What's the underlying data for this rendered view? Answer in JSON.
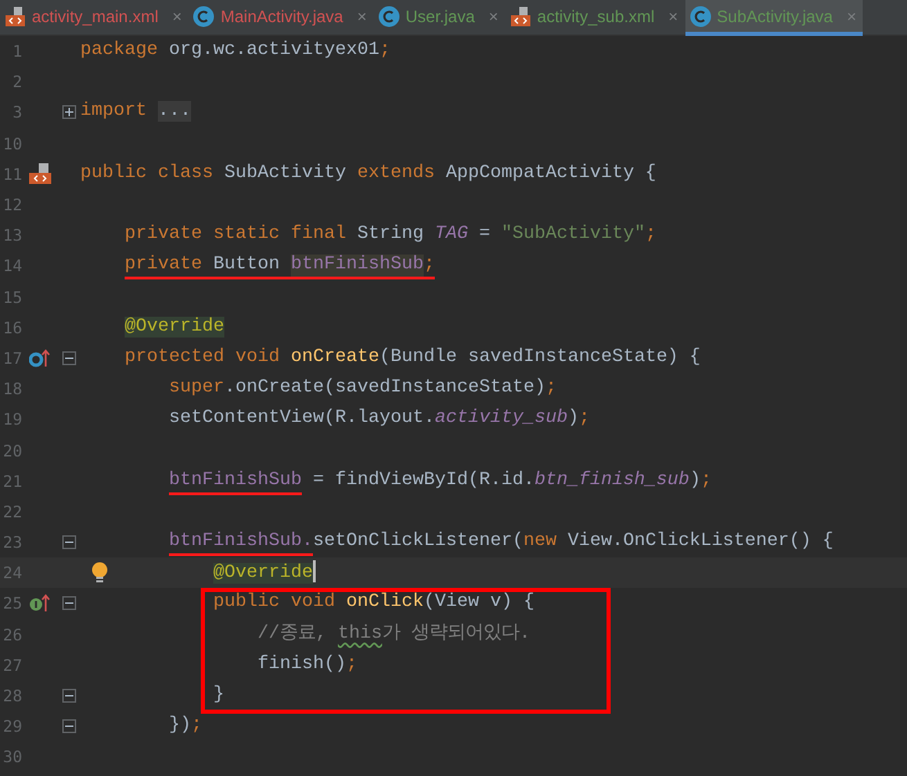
{
  "tabs": [
    {
      "label": "activity_main.xml",
      "kind": "xml",
      "color": "#d25252",
      "selected": false,
      "close": "×"
    },
    {
      "label": "MainActivity.java",
      "kind": "class",
      "color": "#d25252",
      "selected": false,
      "close": "×"
    },
    {
      "label": "User.java",
      "kind": "class",
      "color": "#629755",
      "selected": false,
      "close": "×"
    },
    {
      "label": "activity_sub.xml",
      "kind": "xml",
      "color": "#629755",
      "selected": false,
      "close": "×"
    },
    {
      "label": "SubActivity.java",
      "kind": "class",
      "color": "#629755",
      "selected": true,
      "close": "×"
    }
  ],
  "lines": [
    {
      "number": "1",
      "tokens": [
        {
          "text": "package",
          "kind": "keyword"
        },
        {
          "text": " org.wc.activityex01",
          "kind": "plain"
        },
        {
          "text": ";",
          "kind": "keyword"
        }
      ]
    },
    {
      "number": "2"
    },
    {
      "number": "3",
      "foldable": true,
      "folded": true,
      "tokens": [
        {
          "text": "import ",
          "kind": "keyword"
        },
        {
          "text": "...",
          "kind": "folded"
        }
      ]
    },
    {
      "number": "10"
    },
    {
      "number": "11",
      "xml_marker": true,
      "tokens": [
        {
          "text": "public class",
          "kind": "keyword"
        },
        {
          "text": " SubActivity ",
          "kind": "plain"
        },
        {
          "text": "extends",
          "kind": "keyword"
        },
        {
          "text": " AppCompatActivity {",
          "kind": "plain"
        }
      ]
    },
    {
      "number": "12"
    },
    {
      "number": "13",
      "tokens": [
        {
          "text": "    private static final",
          "kind": "keyword"
        },
        {
          "text": " String ",
          "kind": "plain"
        },
        {
          "text": "TAG",
          "kind": "constant"
        },
        {
          "text": " = ",
          "kind": "plain"
        },
        {
          "text": "\"SubActivity\"",
          "kind": "string"
        },
        {
          "text": ";",
          "kind": "keyword"
        }
      ]
    },
    {
      "number": "14",
      "tokens": [
        {
          "text": "    private",
          "kind": "keyword",
          "underlined": true
        },
        {
          "text": " Button ",
          "kind": "plain",
          "underlined": true
        },
        {
          "text": "btnFinishSub",
          "kind": "field",
          "underlined": true,
          "highlighted": true
        },
        {
          "text": ";",
          "kind": "keyword",
          "underlined": true
        }
      ]
    },
    {
      "number": "15"
    },
    {
      "number": "16",
      "tokens": [
        {
          "text": "    @Override",
          "kind": "annotation",
          "highlighted": true
        }
      ]
    },
    {
      "number": "17",
      "override_marker": true,
      "foldable": true,
      "folded": false,
      "tokens": [
        {
          "text": "    protected void ",
          "kind": "keyword"
        },
        {
          "text": "onCreate",
          "kind": "method"
        },
        {
          "text": "(Bundle savedInstanceState) {",
          "kind": "plain"
        }
      ]
    },
    {
      "number": "18",
      "tokens": [
        {
          "text": "        super",
          "kind": "keyword"
        },
        {
          "text": ".onCreate(savedInstanceState)",
          "kind": "plain"
        },
        {
          "text": ";",
          "kind": "keyword"
        }
      ]
    },
    {
      "number": "19",
      "tokens": [
        {
          "text": "        setContentView(R.layout.",
          "kind": "plain"
        },
        {
          "text": "activity_sub",
          "kind": "constant"
        },
        {
          "text": ")",
          "kind": "plain"
        },
        {
          "text": ";",
          "kind": "keyword"
        }
      ]
    },
    {
      "number": "20"
    },
    {
      "number": "21",
      "tokens": [
        {
          "text": "        btnFinishSub",
          "kind": "field",
          "underlined": true
        },
        {
          "text": " = findViewById(R.id.",
          "kind": "plain"
        },
        {
          "text": "btn_finish_sub",
          "kind": "constant"
        },
        {
          "text": ")",
          "kind": "plain"
        },
        {
          "text": ";",
          "kind": "keyword"
        }
      ]
    },
    {
      "number": "22"
    },
    {
      "number": "23",
      "foldable": true,
      "folded": false,
      "tokens": [
        {
          "text": "        btnFinishSub.",
          "kind": "field",
          "underlined": true
        },
        {
          "text": "setOnClickListener(",
          "kind": "plain"
        },
        {
          "text": "new",
          "kind": "keyword"
        },
        {
          "text": " View.OnClickListener() {",
          "kind": "plain"
        }
      ]
    },
    {
      "number": "24",
      "current": true,
      "bulb": true,
      "tokens": [
        {
          "text": "            @Override",
          "kind": "annotation",
          "highlighted": true
        }
      ]
    },
    {
      "number": "25",
      "implement_marker": true,
      "foldable": true,
      "folded": false,
      "boxed": true,
      "tokens": [
        {
          "text": "            public void ",
          "kind": "keyword"
        },
        {
          "text": "onClick",
          "kind": "method"
        },
        {
          "text": "(View v) {",
          "kind": "plain"
        }
      ]
    },
    {
      "number": "26",
      "boxed": true,
      "tokens": [
        {
          "text": "                //종료, ",
          "kind": "comment"
        },
        {
          "text": "this",
          "kind": "comment",
          "typo": true
        },
        {
          "text": "가 생략되어있다.",
          "kind": "comment"
        }
      ]
    },
    {
      "number": "27",
      "boxed": true,
      "tokens": [
        {
          "text": "                finish()",
          "kind": "plain"
        },
        {
          "text": ";",
          "kind": "keyword"
        }
      ]
    },
    {
      "number": "28",
      "foldable": true,
      "folded": false,
      "boxed": true,
      "tokens": [
        {
          "text": "            }",
          "kind": "plain"
        }
      ]
    },
    {
      "number": "29",
      "foldable": true,
      "folded": false,
      "tokens": [
        {
          "text": "        })",
          "kind": "plain"
        },
        {
          "text": ";",
          "kind": "keyword"
        }
      ]
    },
    {
      "number": "30"
    }
  ]
}
